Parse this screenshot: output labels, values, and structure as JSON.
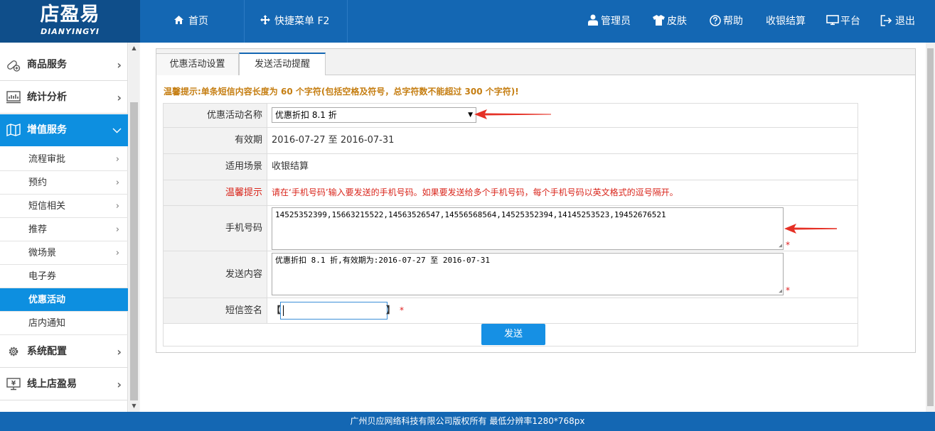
{
  "header": {
    "logo_cn": "店盈易",
    "logo_en": "DIANYINGYI",
    "nav": {
      "home": "首页",
      "quick_menu": "快捷菜单 F2"
    },
    "actions": {
      "admin": "管理员",
      "skin": "皮肤",
      "help": "帮助",
      "checkout": "收银结算",
      "platform": "平台",
      "logout": "退出"
    },
    "colors": {
      "bar": "#1467b3",
      "logo": "#0f4e8a",
      "accent": "#0d8fe0"
    }
  },
  "sidebar": {
    "groups": {
      "goods": "商品服务",
      "stats": "统计分析",
      "vas": "增值服务",
      "config": "系统配置",
      "online": "线上店盈易"
    },
    "sub_items": [
      {
        "label": "流程审批",
        "chevron": "›"
      },
      {
        "label": "预约",
        "chevron": "›"
      },
      {
        "label": "短信相关",
        "chevron": "›"
      },
      {
        "label": "推荐",
        "chevron": "›"
      },
      {
        "label": "微场景",
        "chevron": "›"
      },
      {
        "label": "电子券",
        "chevron": ""
      },
      {
        "label": "优惠活动",
        "chevron": ""
      },
      {
        "label": "店内通知",
        "chevron": ""
      }
    ],
    "active_group": "增值服务",
    "active_item": "优惠活动"
  },
  "tabs": {
    "settings": "优惠活动设置",
    "send_reminder": "发送活动提醒"
  },
  "warn_tip": "温馨提示:单条短信内容长度为 60 个字符(包括空格及符号，总字符数不能超过 300 个字符)!",
  "form": {
    "activity_name": {
      "label": "优惠活动名称",
      "value": "优惠折扣 8.1 折"
    },
    "validity": {
      "label": "有效期",
      "value": "2016-07-27 至 2016-07-31"
    },
    "scene": {
      "label": "适用场景",
      "value": "收银结算"
    },
    "tip": {
      "label": "温馨提示",
      "value": "请在‘手机号码’输入要发送的手机号码。如果要发送给多个手机号码，每个手机号码以英文格式的逗号隔开。"
    },
    "phones": {
      "label": "手机号码",
      "value": "14525352399,15663215522,14563526547,14556568564,14525352394,14145253523,19452676521"
    },
    "content": {
      "label": "发送内容",
      "value": "优惠折扣 8.1 折,有效期为:2016-07-27 至 2016-07-31"
    },
    "signature": {
      "label": "短信签名",
      "left_bracket": "【",
      "right_bracket": "】",
      "value": ""
    },
    "required_mark": "*",
    "send_button": "发送"
  },
  "footer": "广州贝应网络科技有限公司版权所有 最低分辨率1280*768px"
}
